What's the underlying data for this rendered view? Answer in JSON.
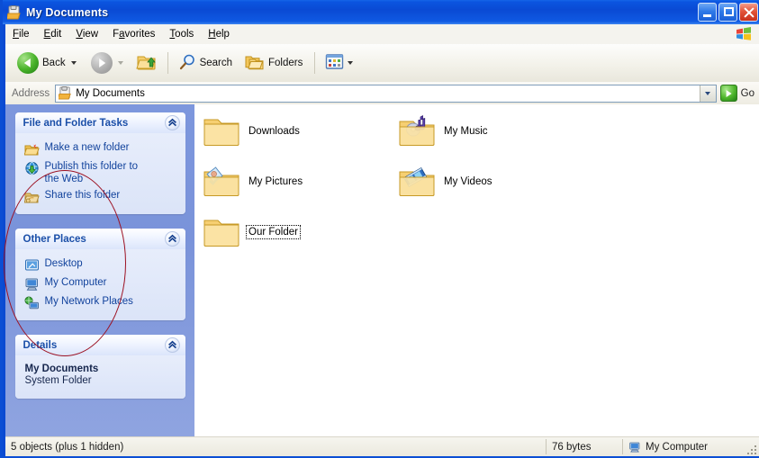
{
  "window": {
    "title": "My Documents",
    "title_icon": "my-documents-icon",
    "controls": [
      {
        "name": "minimize-button",
        "glyph": "minimize"
      },
      {
        "name": "maximize-button",
        "glyph": "maximize"
      },
      {
        "name": "close-button",
        "glyph": "close"
      }
    ]
  },
  "menubar": {
    "items": [
      {
        "label": "File",
        "accel": "F",
        "rest": "ile"
      },
      {
        "label": "Edit",
        "accel": "E",
        "rest": "dit"
      },
      {
        "label": "View",
        "accel": "V",
        "rest": "iew"
      },
      {
        "label": "Favorites",
        "pre": "F",
        "accel": "a",
        "rest": "vorites"
      },
      {
        "label": "Tools",
        "accel": "T",
        "rest": "ools"
      },
      {
        "label": "Help",
        "accel": "H",
        "rest": "elp"
      }
    ],
    "logo": "windows-flag-logo"
  },
  "toolbar": {
    "back_label": "Back",
    "forward_label": "",
    "up_label": "",
    "search_label": "Search",
    "folders_label": "Folders",
    "views_label": ""
  },
  "address": {
    "label": "Address",
    "value": "My Documents",
    "placeholder": "My Documents",
    "go_label": "Go"
  },
  "sidebar": {
    "panels": [
      {
        "id": "file-and-folder-tasks",
        "title": "File and Folder Tasks",
        "items": [
          {
            "label": "Make a new folder",
            "icon": "new-folder-icon"
          },
          {
            "label": "Publish this folder to the Web",
            "icon": "publish-web-icon"
          },
          {
            "label": "Share this folder",
            "icon": "share-folder-icon"
          }
        ]
      },
      {
        "id": "other-places",
        "title": "Other Places",
        "items": [
          {
            "label": "Desktop",
            "icon": "desktop-icon"
          },
          {
            "label": "My Computer",
            "icon": "my-computer-icon"
          },
          {
            "label": "My Network Places",
            "icon": "network-places-icon"
          }
        ]
      }
    ],
    "details": {
      "title": "Details",
      "name": "My Documents",
      "type": "System Folder"
    }
  },
  "files": {
    "items": [
      {
        "label": "Downloads",
        "icon": "folder-plain-icon",
        "focused": false
      },
      {
        "label": "My Music",
        "icon": "folder-music-icon",
        "focused": false
      },
      {
        "label": "My Pictures",
        "icon": "folder-pictures-icon",
        "focused": false
      },
      {
        "label": "My Videos",
        "icon": "folder-videos-icon",
        "focused": false
      },
      {
        "label": "Our  Folder",
        "icon": "folder-plain-icon",
        "focused": true
      }
    ]
  },
  "annotation": {
    "shape": "ellipse",
    "color": "#9c1122",
    "targets": "Our  Folder"
  },
  "statusbar": {
    "objects": "5 objects (plus 1 hidden)",
    "size": "76 bytes",
    "location": "My Computer",
    "location_icon": "my-computer-icon"
  },
  "colors": {
    "titlebar_blue": "#0a4ad2",
    "sidebar_blue": "#7d97dd",
    "panel_header": "#dbe5fb",
    "link_blue": "#11429c",
    "annotation_red": "#9c1122"
  }
}
